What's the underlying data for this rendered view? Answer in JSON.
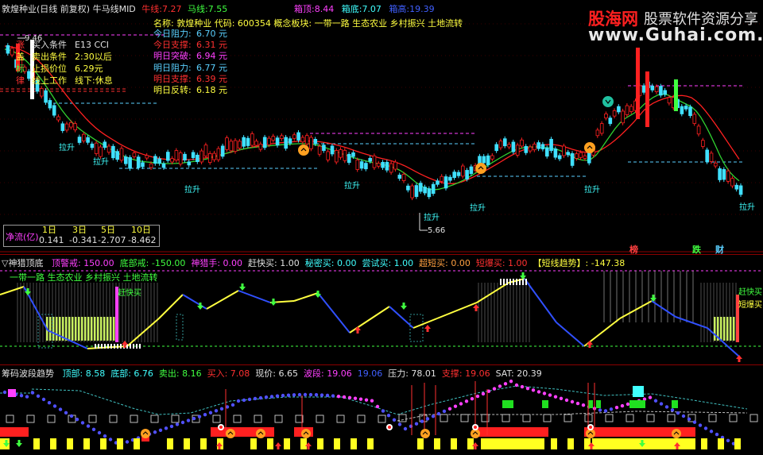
{
  "header": {
    "title": "敦煌种业(日线 前复权) 牛马线MID",
    "niu_label": "牛线:",
    "niu_value": "7.27",
    "ma_label": "马线:",
    "ma_value": "7.55",
    "box_top_label": "箱顶:",
    "box_top_value": "8.44",
    "box_bottom_label": "箱底:",
    "box_bottom_value": "7.07",
    "box_mid_label": "箱高:",
    "box_mid_value": "19.39"
  },
  "info": {
    "name_line": "名称: 敦煌种业 代码: 600354  概念板块: 一带一路 生态农业 乡村振兴 土地流转",
    "rows": [
      {
        "label": "今日阻力:",
        "value": "6.70 元",
        "color": "#5ad0ff"
      },
      {
        "label": "今日支撑:",
        "value": "6.31 元",
        "color": "#ff3030"
      },
      {
        "label": "明日突破:",
        "value": "6.94 元",
        "color": "#ff40ff"
      },
      {
        "label": "明日阻力:",
        "value": "6.77 元",
        "color": "#5ad0ff"
      },
      {
        "label": "明日支撑:",
        "value": "6.39 元",
        "color": "#ff3030"
      },
      {
        "label": "明日反转:",
        "value": "6.18 元",
        "color": "#ffff40"
      }
    ]
  },
  "left_box": {
    "rows": [
      {
        "a": "买入条件",
        "b": "E13 CCI"
      },
      {
        "a": "卖出条件",
        "b": "2:30以后"
      },
      {
        "a": "止损价位",
        "b": "6.29元"
      },
      {
        "a": "线上工作",
        "b": "线下:休息"
      }
    ],
    "left_chars": [
      "涨",
      "盖",
      "标",
      "律"
    ]
  },
  "price_labels": {
    "high": "9.46",
    "low": "5.66",
    "lasheng": "拉升",
    "markers": [
      "榜",
      "跌",
      "财"
    ]
  },
  "net_flow": {
    "label": "净流(亿)",
    "headers": [
      "1日",
      "3日",
      "5日",
      "10日"
    ],
    "values": [
      "0.141",
      "-0.341",
      "-2.707",
      "-8.462"
    ]
  },
  "mid_panel": {
    "title": "▽神猎顶底",
    "items": [
      {
        "text": "顶警戒: 150.00",
        "color": "#ff40ff"
      },
      {
        "text": "底部戒: -150.00",
        "color": "#40ff40"
      },
      {
        "text": "神猎手: 0.00",
        "color": "#ff40ff"
      },
      {
        "text": "赶快买: 1.00",
        "color": "#e0e0e0"
      },
      {
        "text": "秘密买: 0.00",
        "color": "#40ffff"
      },
      {
        "text": "尝试买: 1.00",
        "color": "#40ffff"
      },
      {
        "text": "超短买: 0.00",
        "color": "#ffa040"
      },
      {
        "text": "短爆买: 1.00",
        "color": "#ff3030"
      },
      {
        "text": "【短线趋势】: -147.38",
        "color": "#ffff40"
      }
    ],
    "concept": "一带一路 生态农业 乡村振兴 土地流转",
    "kuai_mai": "赶快买",
    "right_a": "赶快买",
    "right_b": "短爆买"
  },
  "bot_panel": {
    "title": "筹码波段趋势",
    "items": [
      {
        "text": "顶部: 8.58",
        "color": "#40ffff"
      },
      {
        "text": "底部: 6.76",
        "color": "#40ffff"
      },
      {
        "text": "卖出: 8.16",
        "color": "#40ff40"
      },
      {
        "text": "买入: 7.08",
        "color": "#ff3030"
      },
      {
        "text": "现价: 6.65",
        "color": "#e0e0e0"
      },
      {
        "text": "波段: 19.06",
        "color": "#ff40ff"
      },
      {
        "text": "19.06",
        "color": "#4060ff"
      },
      {
        "text": "压力: 78.01",
        "color": "#e0e0e0"
      },
      {
        "text": "支撑: 19.06",
        "color": "#ff3030"
      },
      {
        "text": "SAT: 20.39",
        "color": "#e0e0e0"
      }
    ]
  },
  "logo": {
    "brand": "股海网",
    "slogan": "股票软件资源分享",
    "url": "www.Guhai.com.cn"
  }
}
